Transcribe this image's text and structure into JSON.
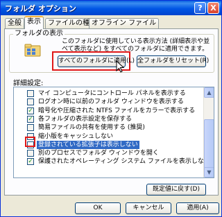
{
  "window": {
    "title": "フォルダ オプション",
    "help_glyph": "?",
    "close_glyph": "X"
  },
  "tabs": [
    {
      "label": "全般",
      "active": false
    },
    {
      "label": "表示",
      "active": true
    },
    {
      "label": "ファイルの種類",
      "active": false
    },
    {
      "label": "オフライン ファイル",
      "active": false
    }
  ],
  "folder_view": {
    "legend": "フォルダの表示",
    "description": "このフォルダに使用している表示方法 (詳細表示や並べて表示など) をすべてのフォルダに適用できます。",
    "apply_all_label": "すべてのフォルダに適用(L)",
    "reset_all_label": "全フォルダをリセット(R)",
    "icon": "folder-view-icon"
  },
  "advanced": {
    "label": "詳細設定:",
    "items": [
      {
        "label": "マイ コンピュータにコントロール パネルを表示する",
        "checked": false,
        "selected": false
      },
      {
        "label": "ログオン時に以前のフォルダ ウィンドウを表示する",
        "checked": false,
        "selected": false
      },
      {
        "label": "暗号化や圧縮された NTFS ファイルをカラーで表示する",
        "checked": true,
        "selected": false
      },
      {
        "label": "各フォルダの表示設定を保存する",
        "checked": true,
        "selected": false
      },
      {
        "label": "簡易ファイルの共有を使用する (推奨)",
        "checked": false,
        "selected": false
      },
      {
        "label": "縮小版をキャッシュしない",
        "checked": false,
        "selected": false
      },
      {
        "label": "登録されている拡張子は表示しない",
        "checked": false,
        "selected": true
      },
      {
        "label": "別のプロセスでフォルダ ウィンドウを開く",
        "checked": false,
        "selected": false
      },
      {
        "label": "保護されたオペレーティング システム ファイルを表示しない (推奨)",
        "checked": true,
        "selected": false
      }
    ],
    "restore_label": "既定値に戻す(D)"
  },
  "footer": {
    "ok_label": "OK",
    "cancel_label": "キャンセル",
    "apply_label": "適用(A)"
  },
  "colors": {
    "titlebar": "#0055e5",
    "highlight_annotation": "#e01818",
    "selection": "#316ac5",
    "checkmark": "#21a121"
  }
}
